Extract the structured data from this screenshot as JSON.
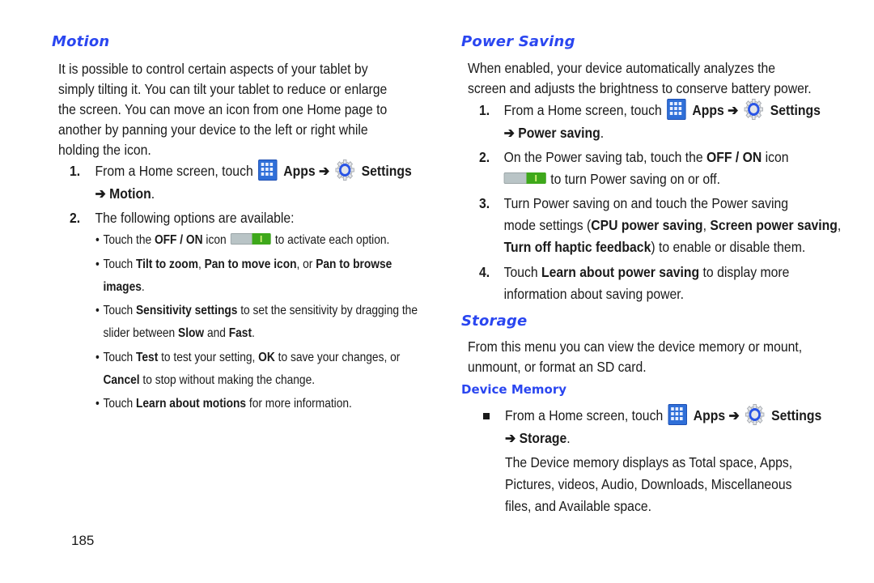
{
  "page_number": "185",
  "colors": {
    "heading": "#2a46f0",
    "text": "#1a1a1a",
    "apps_icon": "#2f6fd8",
    "toggle_on": "#3ea81b",
    "toggle_off": "#b9c4c6"
  },
  "common": {
    "from_home": "From a Home screen, touch",
    "apps": "Apps",
    "arrow": "➔",
    "settings": "Settings",
    "icons": {
      "apps": "apps-grid-icon",
      "settings": "settings-gear-icon",
      "toggle": "off-on-toggle-icon"
    }
  },
  "motion": {
    "title": "Motion",
    "intro_lines": [
      "It is possible to control certain aspects of your tablet by",
      "simply tilting it. You can tilt your tablet to reduce or enlarge",
      "the screen. You can move an icon from one Home page to",
      "another by panning your device to the left or right while",
      "holding the icon."
    ],
    "step1": {
      "num": "1.",
      "dest": "Motion"
    },
    "step2": {
      "num": "2.",
      "text": "The following options are available:"
    },
    "bullets": {
      "b1": {
        "pre": "Touch the ",
        "bold": "OFF / ON",
        "mid": " icon",
        "post": "to activate each option."
      },
      "b2": {
        "pre": "Touch ",
        "bold1": "Tilt to zoom",
        "sep1": ", ",
        "bold2": "Pan to move icon",
        "sep2": ", or ",
        "bold3": "Pan to browse",
        "bold4": "images",
        "end": "."
      },
      "b3": {
        "pre": "Touch ",
        "bold1": "Sensitivity settings",
        "mid": " to set the sensitivity by dragging the",
        "line2pre": "slider between ",
        "bold2": "Slow",
        "and": " and ",
        "bold3": "Fast",
        "end": "."
      },
      "b4": {
        "pre": "Touch ",
        "bold1": "Test",
        "mid1": " to test your setting, ",
        "bold2": "OK",
        "mid2": " to save your changes, or",
        "bold3": "Cancel",
        "end": " to stop without making the change."
      },
      "b5": {
        "pre": "Touch ",
        "bold": "Learn about motions",
        "end": " for more information."
      }
    }
  },
  "power_saving": {
    "title": "Power Saving",
    "intro_lines": [
      "When enabled, your device automatically analyzes the",
      "screen and adjusts the brightness to conserve battery power."
    ],
    "step1": {
      "num": "1.",
      "dest": "Power saving"
    },
    "step2": {
      "num": "2.",
      "pre": "On the Power saving tab, touch the ",
      "bold": "OFF / ON",
      "mid": " icon",
      "post": "to turn Power saving on or off."
    },
    "step3": {
      "num": "3.",
      "line1": "Turn Power saving on and touch the Power saving",
      "line2pre": "mode settings (",
      "bold1": "CPU power saving",
      "sep": ", ",
      "bold2": "Screen power saving",
      "comma": ",",
      "bold3": "Turn off haptic feedback",
      "end": ") to enable or disable them."
    },
    "step4": {
      "num": "4.",
      "pre": "Touch ",
      "bold": "Learn about power saving",
      "end": " to display more",
      "line2": "information about saving power."
    }
  },
  "storage": {
    "title": "Storage",
    "intro_lines": [
      "From this menu you can view the device memory or mount,",
      "unmount, or format an SD card."
    ],
    "device_memory": {
      "title": "Device Memory",
      "dest": "Storage",
      "desc_lines": [
        "The Device memory displays as Total space, Apps,",
        "Pictures, videos, Audio, Downloads, Miscellaneous",
        "files, and Available space."
      ]
    }
  }
}
